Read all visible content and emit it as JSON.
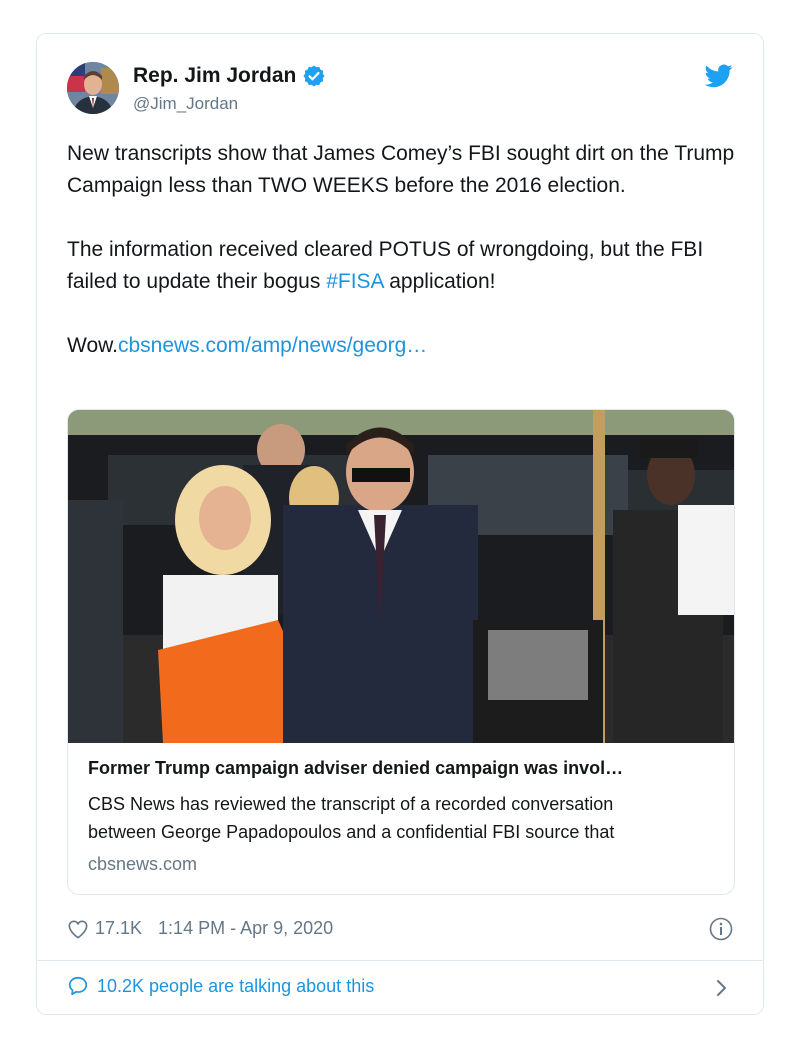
{
  "author": {
    "name": "Rep. Jim Jordan",
    "handle": "@Jim_Jordan"
  },
  "icons": {
    "verified": "verified-badge-icon",
    "brand": "twitter-bird-icon",
    "like": "heart-icon",
    "info": "info-icon",
    "reply": "speech-bubble-icon",
    "more": "chevron-right-icon"
  },
  "tweet": {
    "paragraph1": "New transcripts show that James Comey’s FBI sought dirt on the Trump Campaign less than TWO WEEKS before the 2016 election.",
    "paragraph2_before": "The information received cleared POTUS of wrongdoing, but the FBI failed to update their bogus ",
    "hashtag": "#FISA",
    "paragraph2_after": " application!",
    "paragraph3_prefix": "Wow.",
    "link": "cbsnews.com/amp/news/georg…"
  },
  "card": {
    "title": "Former Trump campaign adviser denied campaign was invol…",
    "description_line1": "CBS News has reviewed the transcript of a recorded conversation",
    "description_line2": "between George Papadopoulos and a confidential FBI source that",
    "domain": "cbsnews.com"
  },
  "meta": {
    "likes": "17.1K",
    "timestamp": "1:14 PM - Apr 9, 2020"
  },
  "footer": {
    "talking": "10.2K people are talking about this"
  },
  "colors": {
    "link": "#1b95e0",
    "secondary_text": "#657786",
    "border": "#e1e8ed",
    "verified": "#1da1f2"
  }
}
